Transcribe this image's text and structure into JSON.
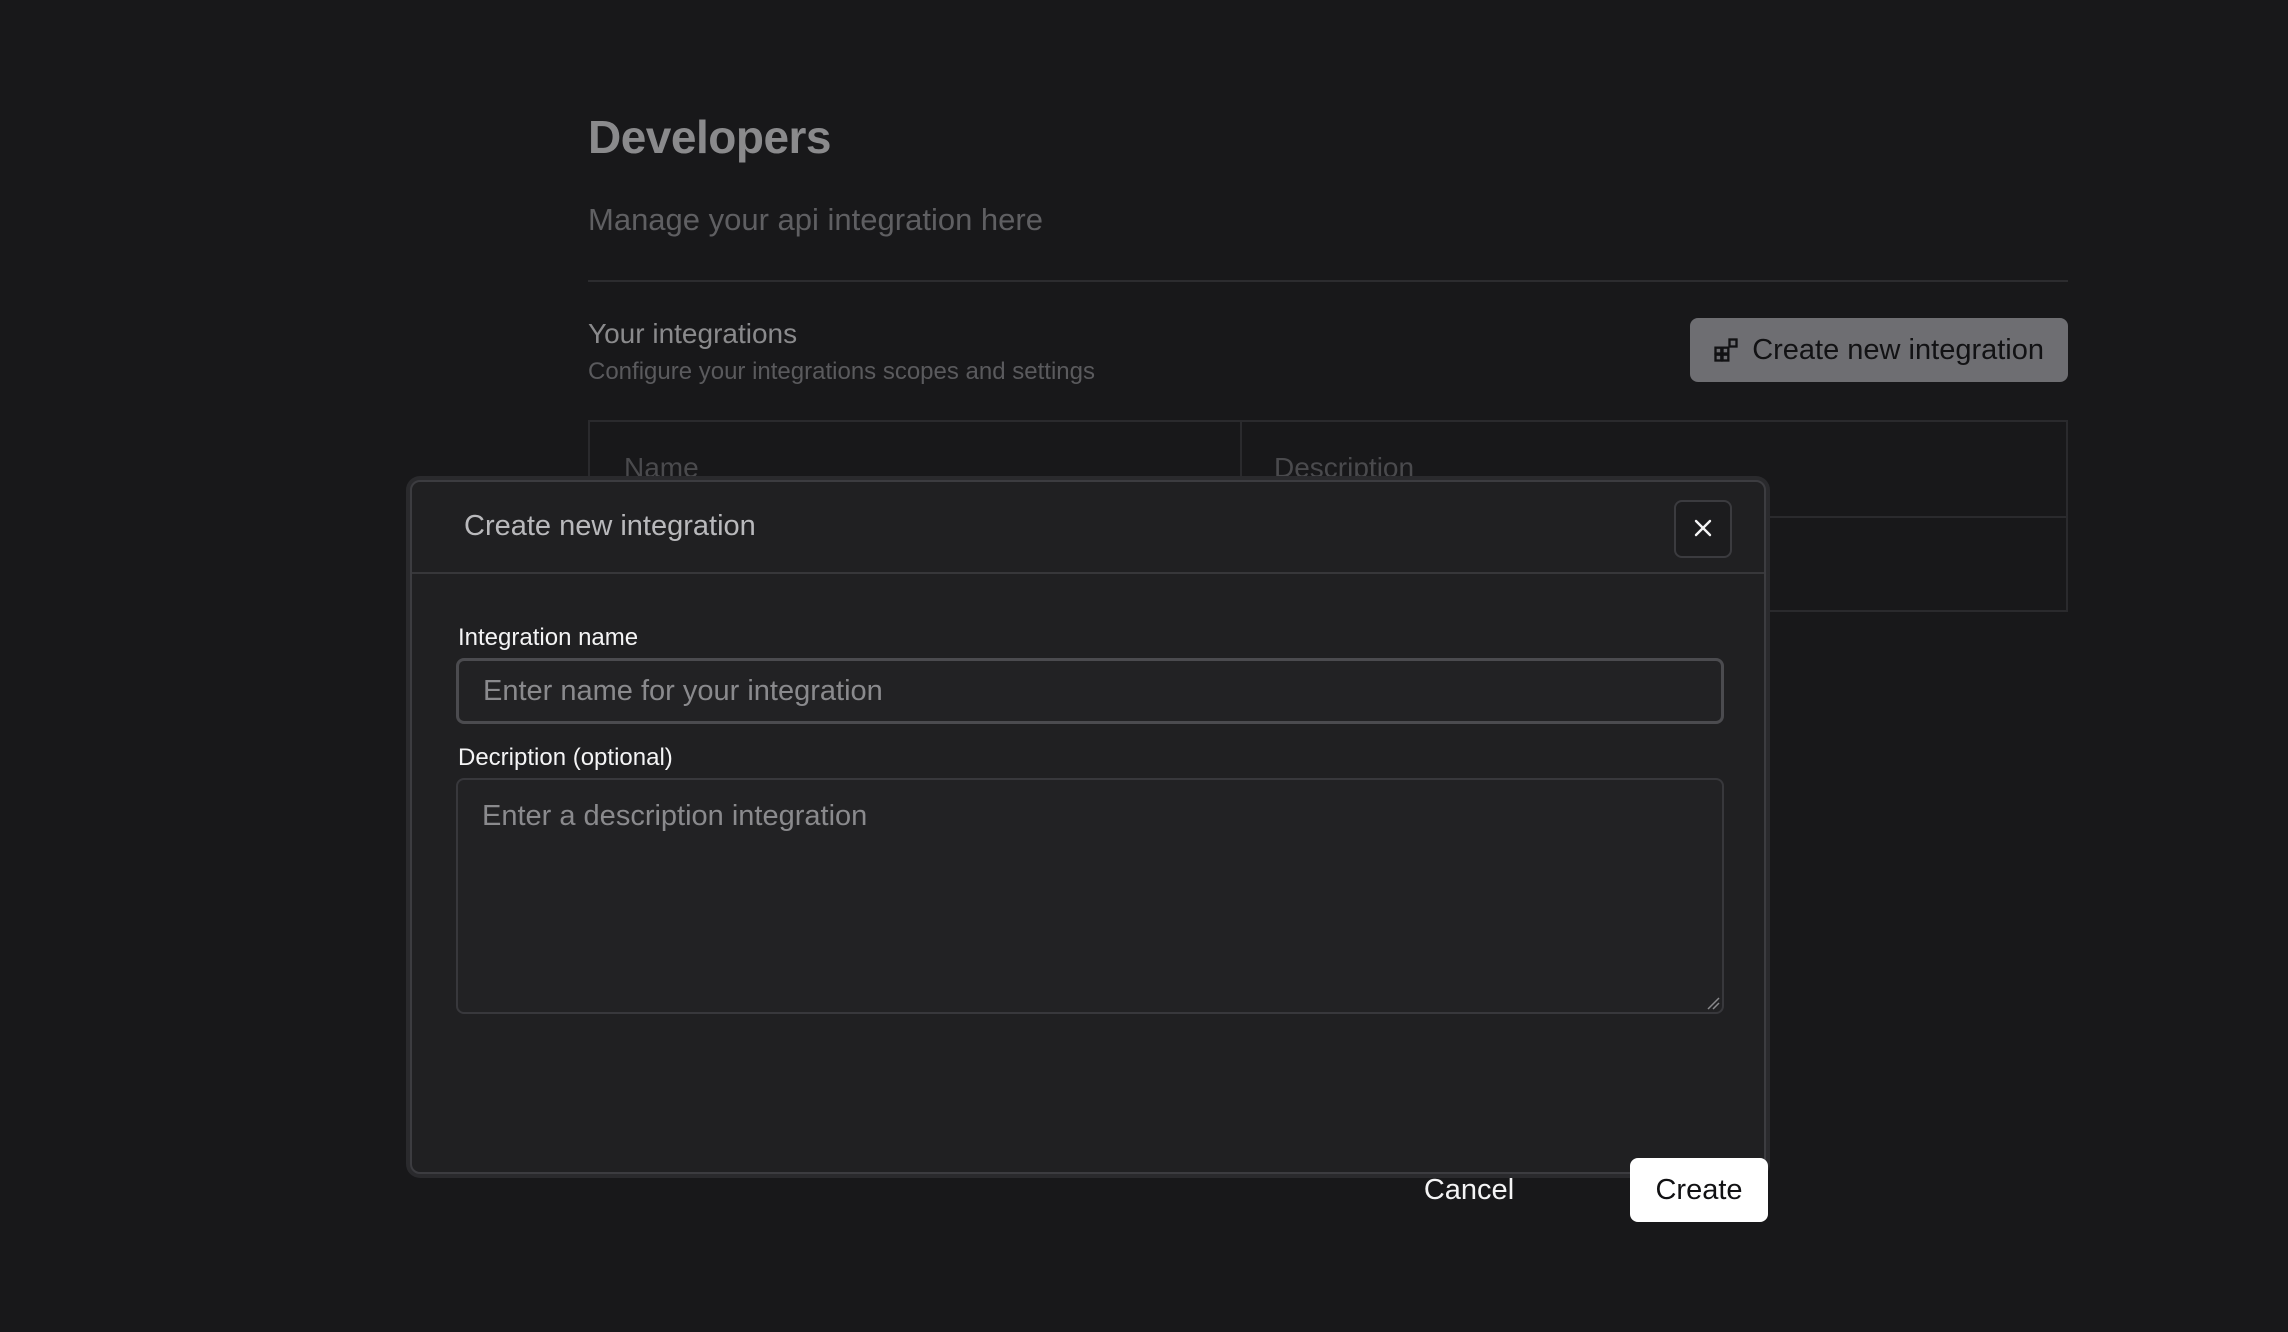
{
  "page": {
    "title": "Developers",
    "subtitle": "Manage your api integration here"
  },
  "integrations": {
    "title": "Your integrations",
    "description": "Configure your integrations scopes and settings",
    "create_button_label": "Create new integration",
    "create_button_icon": "add-widget-icon",
    "table_headers": [
      "Name",
      "Description"
    ]
  },
  "modal": {
    "title": "Create new integration",
    "close_icon": "close-icon",
    "name_label": "Integration name",
    "name_placeholder": "Enter name for your integration",
    "name_value": "",
    "description_label": "Decription (optional)",
    "description_placeholder": "Enter a description integration",
    "description_value": "",
    "cancel_label": "Cancel",
    "create_label": "Create"
  },
  "colors": {
    "background": "#18181a",
    "modal_background": "#202022",
    "primary_button": "#ffffff"
  }
}
